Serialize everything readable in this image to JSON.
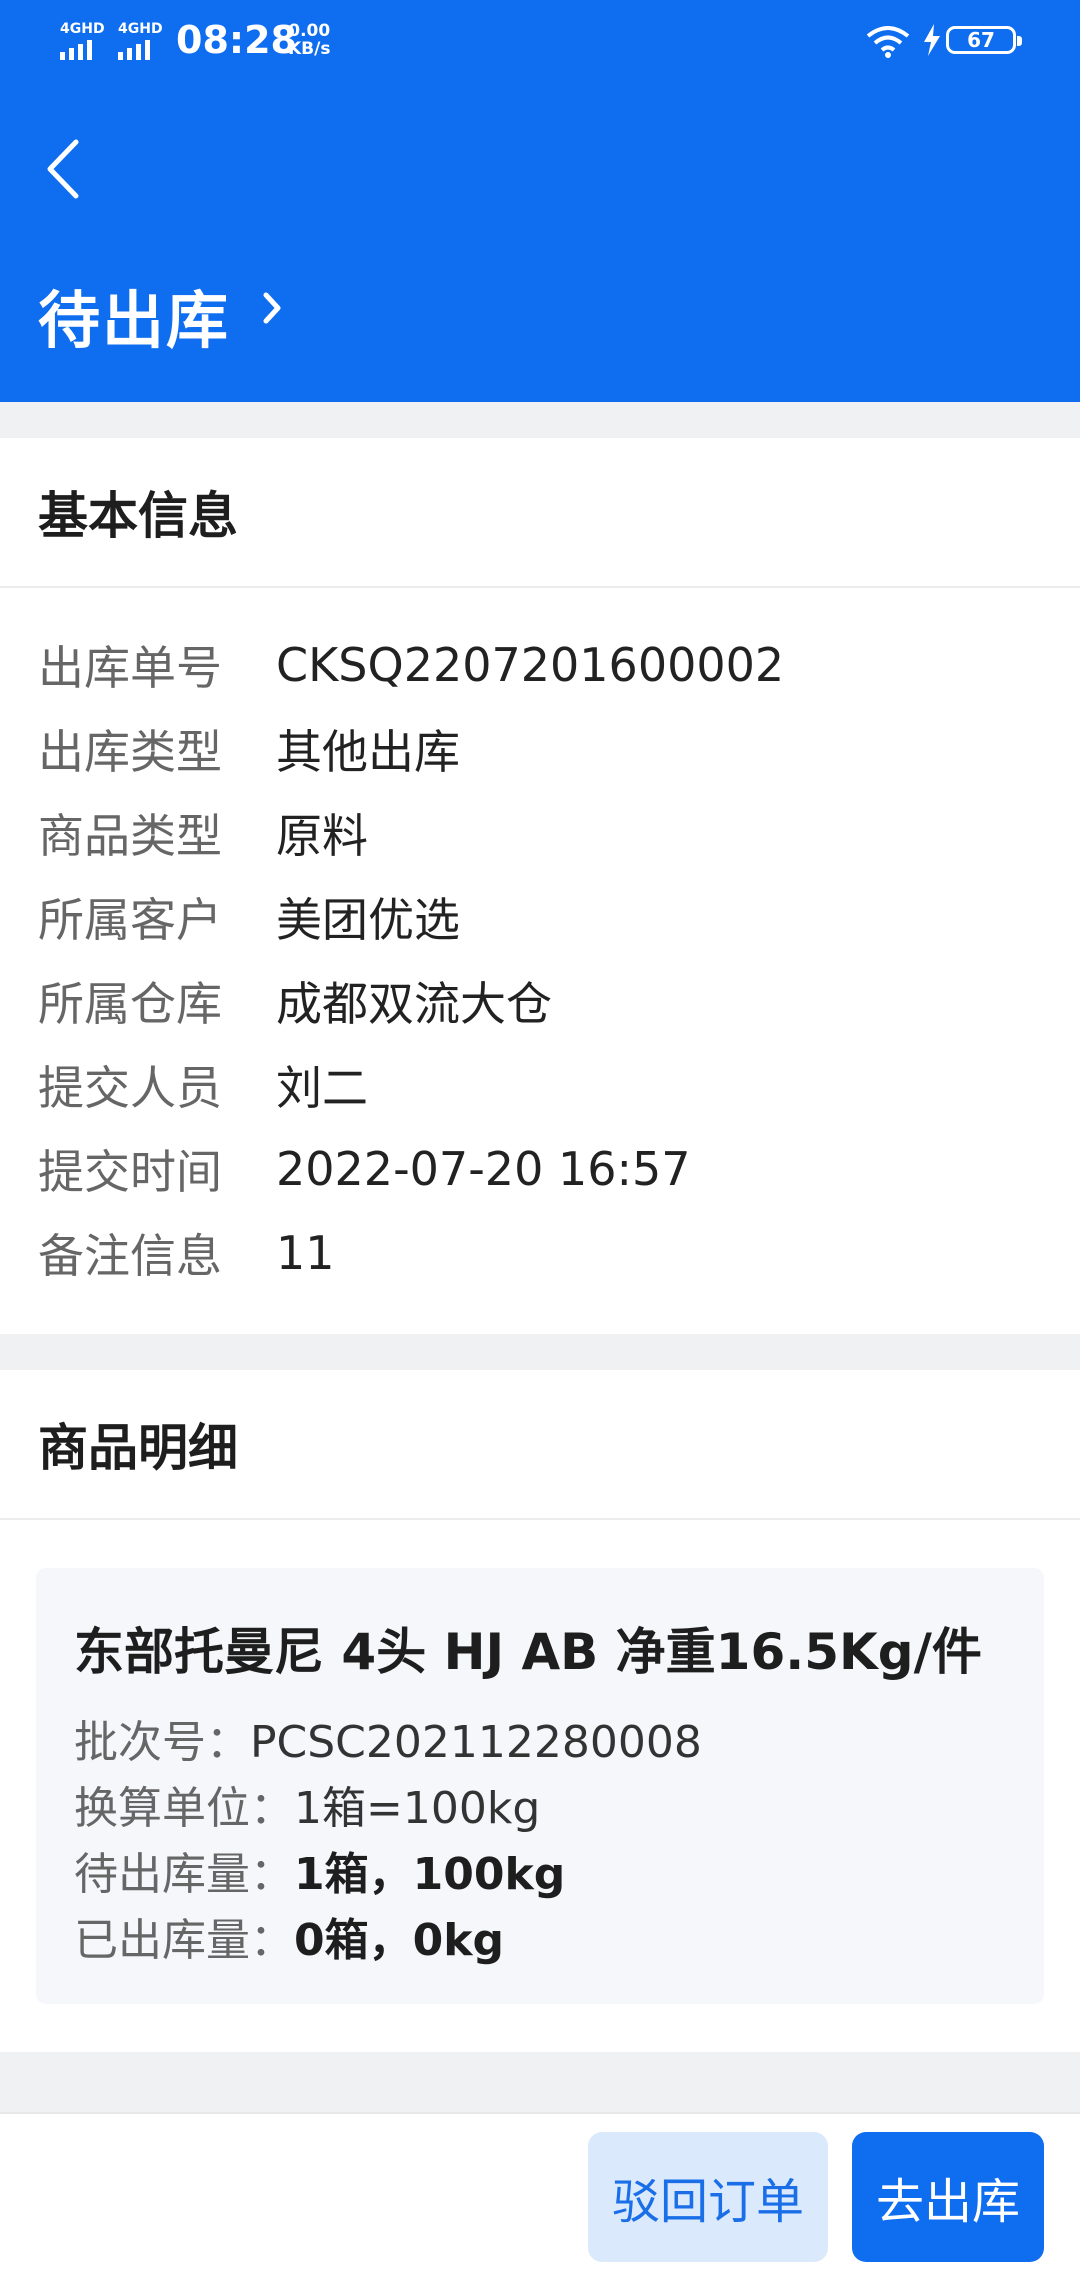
{
  "status_bar": {
    "network_1": "4GHD",
    "network_2": "4GHD",
    "time": "08:28",
    "speed_value": "0.00",
    "speed_unit": "KB/s",
    "battery": "67",
    "icons": [
      "wifi-icon",
      "charging-icon",
      "battery-icon"
    ]
  },
  "header": {
    "title": "待出库",
    "back_icon": "chevron-left-icon",
    "title_icon": "chevron-right-icon",
    "background": "#0f6ef0"
  },
  "basic_info": {
    "heading": "基本信息",
    "rows": [
      {
        "label": "出库单号",
        "value": "CKSQ2207201600002"
      },
      {
        "label": "出库类型",
        "value": "其他出库"
      },
      {
        "label": "商品类型",
        "value": "原料"
      },
      {
        "label": "所属客户",
        "value": "美团优选"
      },
      {
        "label": "所属仓库",
        "value": "成都双流大仓"
      },
      {
        "label": "提交人员",
        "value": "刘二"
      },
      {
        "label": "提交时间",
        "value": "2022-07-20 16:57"
      },
      {
        "label": "备注信息",
        "value": "11"
      }
    ]
  },
  "goods": {
    "heading": "商品明细",
    "items": [
      {
        "name": "东部托曼尼 4头 HJ AB 净重16.5Kg/件",
        "batch_label": "批次号：",
        "batch_value": "PCSC202112280008",
        "unit_label": "换算单位：",
        "unit_value": "1箱=100kg",
        "pending_label": "待出库量：",
        "pending_value": "1箱，100kg",
        "done_label": "已出库量：",
        "done_value": "0箱，0kg"
      }
    ]
  },
  "actions": {
    "reject_label": "驳回订单",
    "outbound_label": "去出库",
    "accent": "#0f6ef0"
  }
}
